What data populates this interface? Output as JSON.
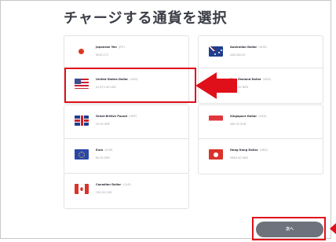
{
  "page": {
    "title": "チャージする通貨を選択"
  },
  "currencies": [
    {
      "flag": "jp-flag-icon",
      "name": "Japanese Yen",
      "code": "(JPY)",
      "balance": "¥500,171"
    },
    {
      "flag": "au-flag-icon",
      "name": "Australian Dollar",
      "code": "(AUD)",
      "balance": "A$8,000.00"
    },
    {
      "flag": "us-flag-icon",
      "name": "United States Dollar",
      "code": "(USD)",
      "balance": "$1,672.00 USD"
    },
    {
      "flag": "nz-flag-icon",
      "name": "New Zealand Dollar",
      "code": "(NZD)",
      "balance": "NZ$0.00 NZD"
    },
    {
      "flag": "gb-flag-icon",
      "name": "Great British Pound",
      "code": "(GBP)",
      "balance": "£0.00 GBP"
    },
    {
      "flag": "sg-flag-icon",
      "name": "Singapore Dollar",
      "code": "(SGD)",
      "balance": "S$0.00 SGD"
    },
    {
      "flag": "eu-flag-icon",
      "name": "Euro",
      "code": "(EUR)",
      "balance": "€0.00 EUR"
    },
    {
      "flag": "hk-flag-icon",
      "name": "Hong Kong Dollar",
      "code": "(HKD)",
      "balance": "HK$0.00 HKD"
    },
    {
      "flag": "ca-flag-icon",
      "name": "Canadian Dollar",
      "code": "(CAD)",
      "balance": "C$0.00 CAD"
    }
  ],
  "footer": {
    "next_label": "次へ"
  },
  "colors": {
    "highlight": "#e0101a",
    "button": "#6e727c"
  }
}
